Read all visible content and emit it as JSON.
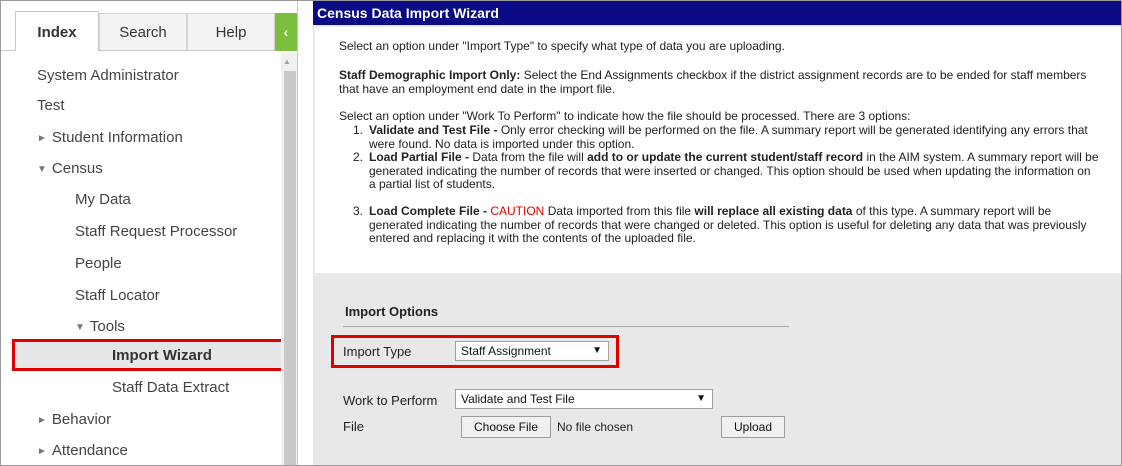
{
  "sidebar": {
    "tabs": {
      "index": "Index",
      "search": "Search",
      "help": "Help"
    },
    "collapse_icon": "‹",
    "items": [
      {
        "label": "System Administrator"
      },
      {
        "label": "Test"
      },
      {
        "label": "Student Information",
        "arrow": "►"
      },
      {
        "label": "Census",
        "arrow": "▼"
      },
      {
        "label": "My Data"
      },
      {
        "label": "Staff Request Processor"
      },
      {
        "label": "People"
      },
      {
        "label": "Staff Locator"
      },
      {
        "label": "Tools",
        "arrow": "▼"
      },
      {
        "label": "Import Wizard"
      },
      {
        "label": "Staff Data Extract"
      },
      {
        "label": "Behavior",
        "arrow": "►"
      },
      {
        "label": "Attendance",
        "arrow": "►"
      }
    ]
  },
  "main": {
    "title": "Census Data Import Wizard",
    "intro": "Select an option under \"Import Type\" to specify what type of data you are uploading.",
    "staff_bold": "Staff Demographic Import Only:",
    "staff_text": " Select the End Assignments checkbox if the district assignment records are to be ended for staff members that have an employment end date in the import file.",
    "work_intro": "Select an option under \"Work To Perform\" to indicate how the file should be processed. There are 3 options:",
    "option1_num": "1.",
    "option1_bold": "Validate and Test File -",
    "option1_text": " Only error checking will be performed on the file. A summary report will be generated identifying any errors that were found. No data is imported under this option.",
    "option2_num": "2.",
    "option2_bold": "Load Partial File -",
    "option2_text_a": " Data from the file will ",
    "option2_bold2": "add to or update the current student/staff record",
    "option2_text_b": " in the AIM system. A summary report will be generated indicating the number of records that were inserted or changed. This option should be used when updating the information on a partial list of students.",
    "option3_num": "3.",
    "option3_bold": "Load Complete File -",
    "option3_caution": " CAUTION",
    "option3_text_a": " Data imported from this file ",
    "option3_bold2": "will replace all existing data",
    "option3_text_b": " of this type. A summary report will be generated indicating the number of records that were changed or deleted. This option is useful for deleting any data that was previously entered and replacing it with the contents of the uploaded file.",
    "import_options_title": "Import Options",
    "import_type_label": "Import Type",
    "import_type_value": "Staff Assignment",
    "work_label": "Work to Perform",
    "work_value": "Validate and Test File",
    "file_label": "File",
    "choose_file": "Choose File",
    "no_file": "No file chosen",
    "upload": "Upload",
    "caret": "▼"
  },
  "colors": {
    "title_bar": "#0a0a85",
    "collapse_button": "#7cbf3c",
    "highlight_border": "#e00000",
    "caution_text": "#e00000"
  }
}
